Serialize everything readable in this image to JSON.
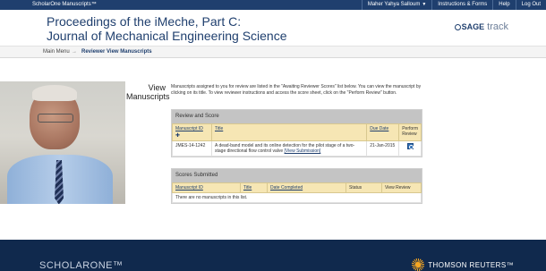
{
  "topbar": {
    "brand": "ScholarOne Manuscripts™",
    "user": "Maher Yahya Salloum",
    "menu": [
      "Instructions & Forms",
      "Help",
      "Log Out"
    ]
  },
  "header": {
    "journal_line1": "Proceedings of the iMeche, Part C:",
    "journal_line2": "Journal of Mechanical Engineering Science",
    "logo_sage": "SAGE",
    "logo_track": "track"
  },
  "breadcrumb": {
    "main_menu": "Main Menu",
    "separator": "→",
    "current": "Reviewer View Manuscripts"
  },
  "page": {
    "title_line1": "View",
    "title_line2": "Manuscripts",
    "intro": "Manuscripts assigned to you for review are listed in the \"Awaiting Reviewer Scores\" list below. You can view the manuscript by clicking on its title. To view reviewer instructions and access the score sheet, click on the \"Perform Review\" button."
  },
  "review_panel": {
    "title": "Review and Score",
    "headers": {
      "manuscript_id": "Manuscript ID",
      "title": "Title",
      "due_date": "Due Date",
      "perform_review": "Perform Review"
    },
    "rows": [
      {
        "manuscript_id": "JMES-14-1242",
        "title": "A dead-band model and its online detection for the pilot stage of a two-stage directional flow control valve",
        "view_submission": "[View Submission]",
        "due_date": "21-Jan-2015"
      }
    ]
  },
  "scores_panel": {
    "title": "Scores Submitted",
    "headers": {
      "manuscript_id": "Manuscript ID",
      "title": "Title",
      "date_completed": "Date Completed",
      "status": "Status",
      "view_review": "View Review"
    },
    "empty_message": "There are no manuscripts in this list."
  },
  "footer": {
    "scholarone": "SCHOLARONE™",
    "thomson": "THOMSON REUTERS™"
  }
}
